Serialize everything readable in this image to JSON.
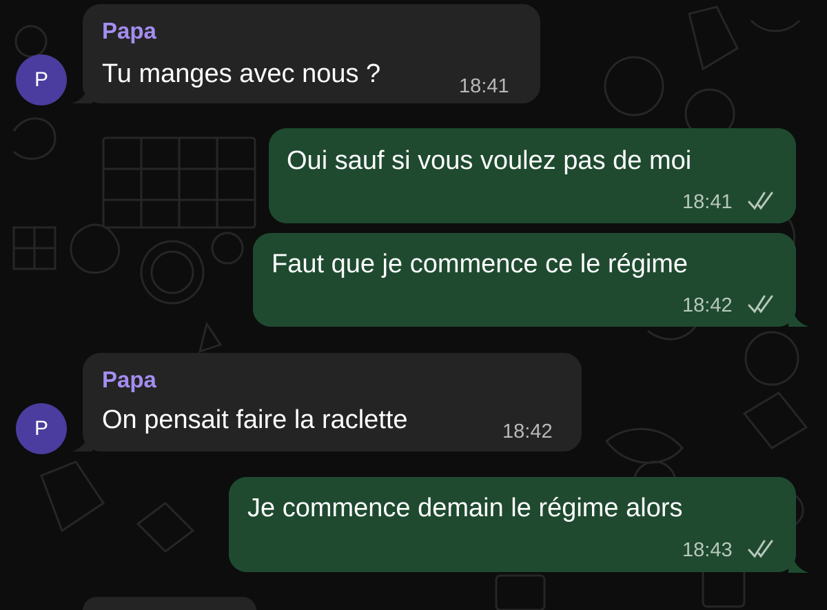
{
  "contact": {
    "avatar_letter": "P"
  },
  "messages": [
    {
      "direction": "in",
      "sender": "Papa",
      "text": "Tu manges avec nous ?",
      "time": "18:41"
    },
    {
      "direction": "out",
      "text": "Oui sauf si vous voulez pas de moi",
      "time": "18:41",
      "status": "read-double-check-icon"
    },
    {
      "direction": "out",
      "text": "Faut que je commence ce le régime",
      "time": "18:42",
      "status": "read-double-check-icon"
    },
    {
      "direction": "in",
      "sender": "Papa",
      "text": "On pensait faire la raclette",
      "time": "18:42"
    },
    {
      "direction": "out",
      "text": "Je commence demain le régime alors",
      "time": "18:43",
      "status": "read-double-check-icon"
    }
  ],
  "colors": {
    "background": "#0d0d0d",
    "incoming_bubble": "#242424",
    "outgoing_bubble": "#1f4a30",
    "sender_name": "#a48df0",
    "avatar": "#4a3d9f"
  }
}
